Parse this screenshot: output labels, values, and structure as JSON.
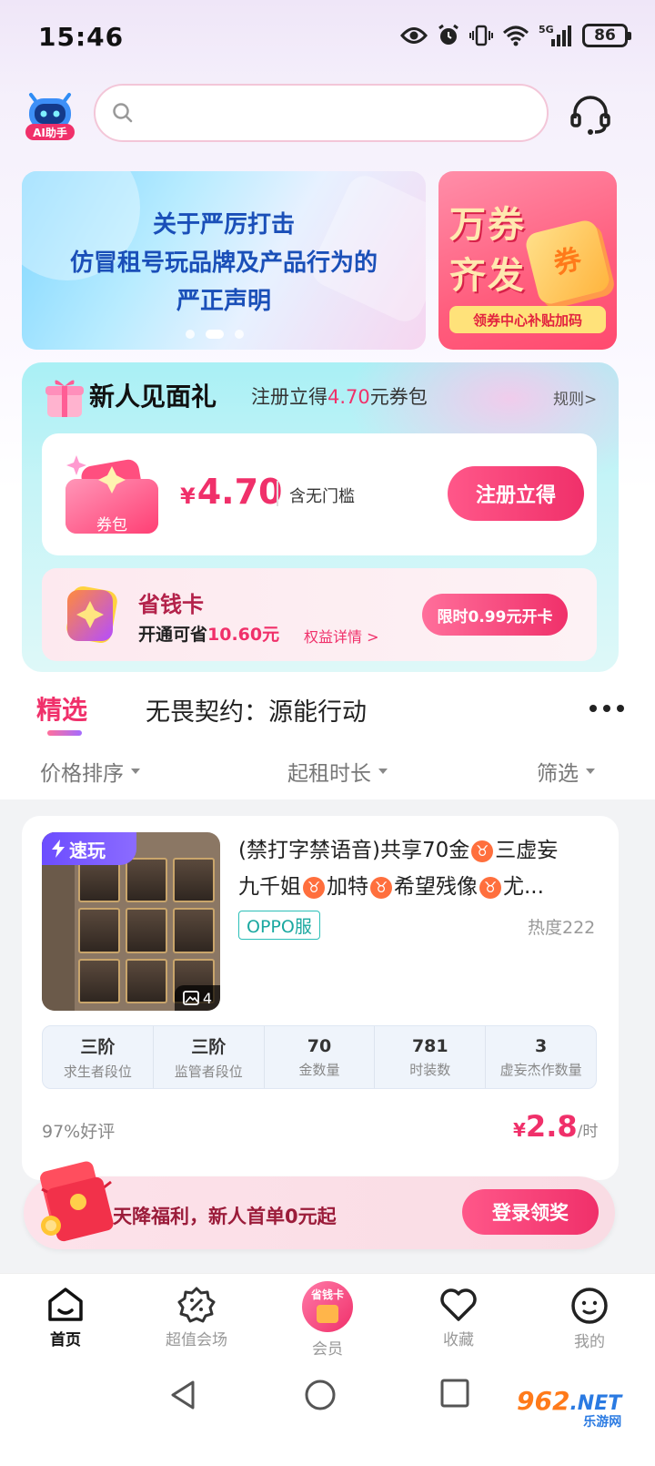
{
  "status_bar": {
    "time": "15:46",
    "network": "5G",
    "battery": "86"
  },
  "header": {
    "ai_label": "AI助手",
    "search_placeholder": ""
  },
  "banner": {
    "lines": [
      "关于严厉打击",
      "仿冒租号玩品牌及产品行为的",
      "严正声明"
    ],
    "side_title_1": "万券",
    "side_title_2": "齐发",
    "side_tag": "领券中心补贴加码",
    "side_coupon_char": "券"
  },
  "gift": {
    "title": "新人见面礼",
    "subtitle_prefix": "注册立得",
    "subtitle_amount": "4.70",
    "subtitle_suffix": "元券包",
    "rules": "规则>",
    "wallet_label": "券包",
    "currency": "¥",
    "price": "4.70",
    "note": "含无门槛",
    "register_button": "注册立得"
  },
  "save_card": {
    "title": "省钱卡",
    "desc_prefix": "开通可省",
    "desc_amount": "10.60元",
    "link": "权益详情 >",
    "button": "限时0.99元开卡"
  },
  "tabs": {
    "selected": "精选",
    "other": "无畏契约：源能行动"
  },
  "filters": {
    "price_sort": "价格排序",
    "rent_duration": "起租时长",
    "filter": "筛选"
  },
  "listing": {
    "badge": "速玩",
    "image_count": "4",
    "title_line1_a": "(禁打字禁语音)共享70金",
    "title_line1_b": "三虚妄",
    "title_line2_a": "九千姐",
    "title_line2_b": "加特",
    "title_line2_c": "希望残像",
    "title_line2_d": "尤...",
    "zodiac_symbol": "♉",
    "server_tag": "OPPO服",
    "hotness": "热度222",
    "stats": [
      {
        "value": "三阶",
        "label": "求生者段位"
      },
      {
        "value": "三阶",
        "label": "监管者段位"
      },
      {
        "value": "70",
        "label": "金数量"
      },
      {
        "value": "781",
        "label": "时装数"
      },
      {
        "value": "3",
        "label": "虚妄杰作数量"
      }
    ],
    "rating": "97%好评",
    "price_currency": "¥",
    "price": "2.8",
    "price_unit": "/时"
  },
  "promo": {
    "text": "天降福利，新人首单0元起",
    "button": "登录领奖"
  },
  "bottom_nav": {
    "items": [
      {
        "label": "首页",
        "icon": "home-icon"
      },
      {
        "label": "超值会场",
        "icon": "discount-icon"
      },
      {
        "label": "会员",
        "icon": "vip-icon"
      },
      {
        "label": "收藏",
        "icon": "heart-icon"
      },
      {
        "label": "我的",
        "icon": "profile-icon"
      }
    ],
    "vip_badge": "省钱卡"
  },
  "watermark": {
    "main": "962",
    "net": ".NET",
    "sub": "乐游网"
  },
  "colors": {
    "accent": "#f0306a",
    "teal": "#2cbfb8",
    "purple": "#6c4dff"
  }
}
